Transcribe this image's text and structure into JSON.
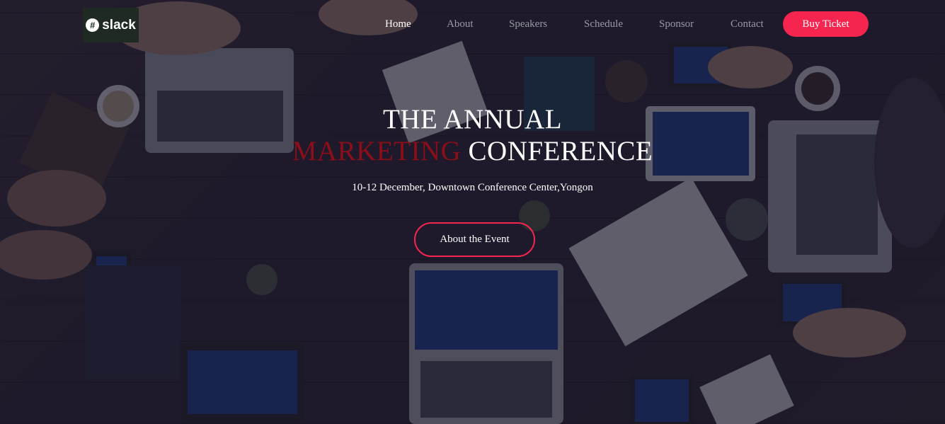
{
  "brand": {
    "name": "slack"
  },
  "nav": {
    "items": [
      "Home",
      "About",
      "Speakers",
      "Schedule",
      "Sponsor",
      "Contact"
    ],
    "active": "Home",
    "buy_ticket": "Buy Ticket"
  },
  "hero": {
    "line1": "THE ANNUAL",
    "line2_accent": "MARKETING",
    "line2_rest": " CONFERENCE",
    "date_location": "10-12 December, Downtown Conference Center,Yongon",
    "cta": "About the Event"
  },
  "colors": {
    "accent": "#f6254f",
    "accent_dark": "#8b0e18",
    "overlay": "#16142a"
  }
}
